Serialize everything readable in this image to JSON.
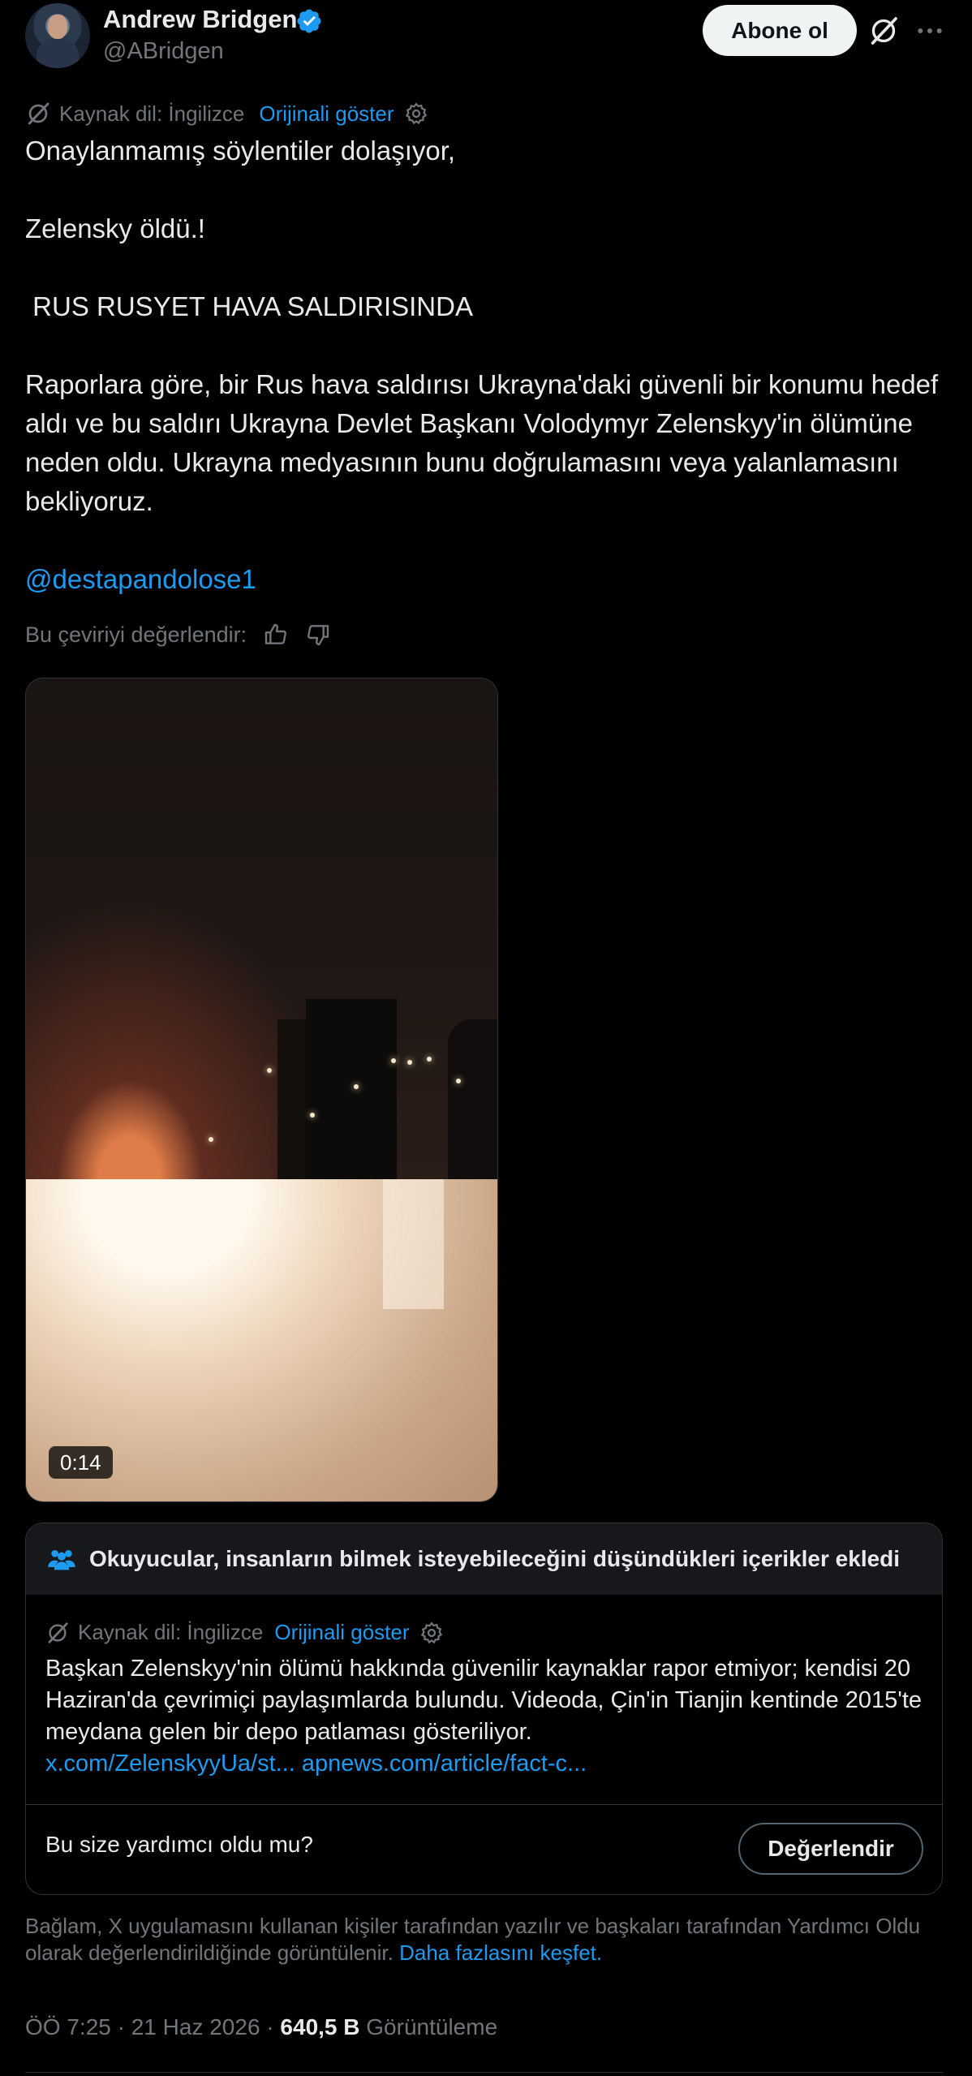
{
  "author": {
    "name": "Andrew Bridgen",
    "handle": "@ABridgen",
    "follow_label": "Abone ol"
  },
  "translation": {
    "source_label": "Kaynak dil: İngilizce",
    "show_original": "Orijinali göster"
  },
  "post": {
    "line1": "Onaylanmamış söylentiler dolaşıyor,",
    "line2": "Zelensky öldü.!",
    "line3": " RUS RUSYET HAVA SALDIRISINDA",
    "paragraph": "Raporlara göre, bir Rus hava saldırısı Ukrayna'daki güvenli bir konumu hedef aldı ve bu saldırı Ukrayna Devlet Başkanı Volodymyr Zelenskyy'in ölümüne neden oldu. Ukrayna medyasının bunu doğrulamasını veya yalanlamasını bekliyoruz.",
    "mention": "@destapandolose1",
    "rate_translation": "Bu çeviriyi değerlendir:"
  },
  "video": {
    "duration": "0:14"
  },
  "community_note": {
    "header": "Okuyucular, insanların bilmek isteyebileceğini düşündükleri içerikler ekledi",
    "source_label": "Kaynak dil: İngilizce",
    "show_original": "Orijinali göster",
    "text": "Başkan Zelenskyy'nin ölümü hakkında güvenilir kaynaklar rapor etmiyor; kendisi 20 Haziran'da çevrimiçi paylaşımlarda bulundu. Videoda, Çin'in Tianjin kentinde 2015'te meydana gelen bir depo patlaması gösteriliyor.",
    "link1": "x.com/ZelenskyyUa/st...",
    "link2": "apnews.com/article/fact-c...",
    "question": "Bu size yardımcı oldu mu?",
    "rate_button": "Değerlendir"
  },
  "disclaimer": {
    "text": "Bağlam, X uygulamasını kullanan kişiler tarafından yazılır ve başkaları tarafından Yardımcı Oldu olarak değerlendirildiğinde görüntülenir.",
    "link": "Daha fazlasını keşfet."
  },
  "meta": {
    "time": "ÖÖ 7:25",
    "date": "21 Haz 2026",
    "views_count": "640,5 B",
    "views_label": "Görüntüleme"
  },
  "colors": {
    "accent": "#1d9bf0",
    "text": "#e7e9ea",
    "muted": "#71767b",
    "background": "#000000"
  }
}
